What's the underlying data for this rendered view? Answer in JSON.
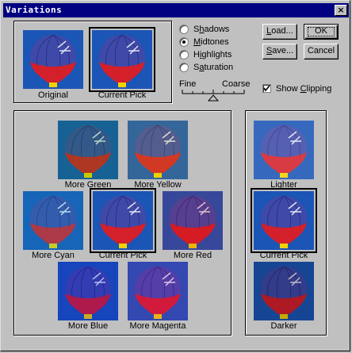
{
  "window": {
    "title": "Variations",
    "close_glyph": "×"
  },
  "top_thumbs": {
    "original": "Original",
    "current": "Current Pick"
  },
  "tone": {
    "options": [
      {
        "pre": "S",
        "acc": "h",
        "post": "adows"
      },
      {
        "pre": "",
        "acc": "M",
        "post": "idtones"
      },
      {
        "pre": "H",
        "acc": "i",
        "post": "ghlights"
      },
      {
        "pre": "S",
        "acc": "a",
        "post": "turation"
      }
    ],
    "selected": 1
  },
  "slider": {
    "fine": "Fine",
    "coarse": "Coarse"
  },
  "buttons": {
    "load": {
      "pre": "",
      "acc": "L",
      "post": "oad..."
    },
    "ok": "OK",
    "save": {
      "pre": "",
      "acc": "S",
      "post": "ave..."
    },
    "cancel": "Cancel"
  },
  "show_clipping": {
    "pre": "Show ",
    "acc": "C",
    "post": "lipping",
    "checked": true
  },
  "color_variations": {
    "more_green": "More Green",
    "more_yellow": "More Yellow",
    "more_cyan": "More Cyan",
    "current": "Current Pick",
    "more_red": "More Red",
    "more_blue": "More Blue",
    "more_magenta": "More Magenta"
  },
  "brightness": {
    "lighter": "Lighter",
    "current": "Current Pick",
    "darker": "Darker"
  },
  "colors": {
    "title_bar": "#000080",
    "sky": "#1b55b5",
    "balloon_top": "#3f4aa8",
    "balloon_bottom": "#d4202b"
  }
}
